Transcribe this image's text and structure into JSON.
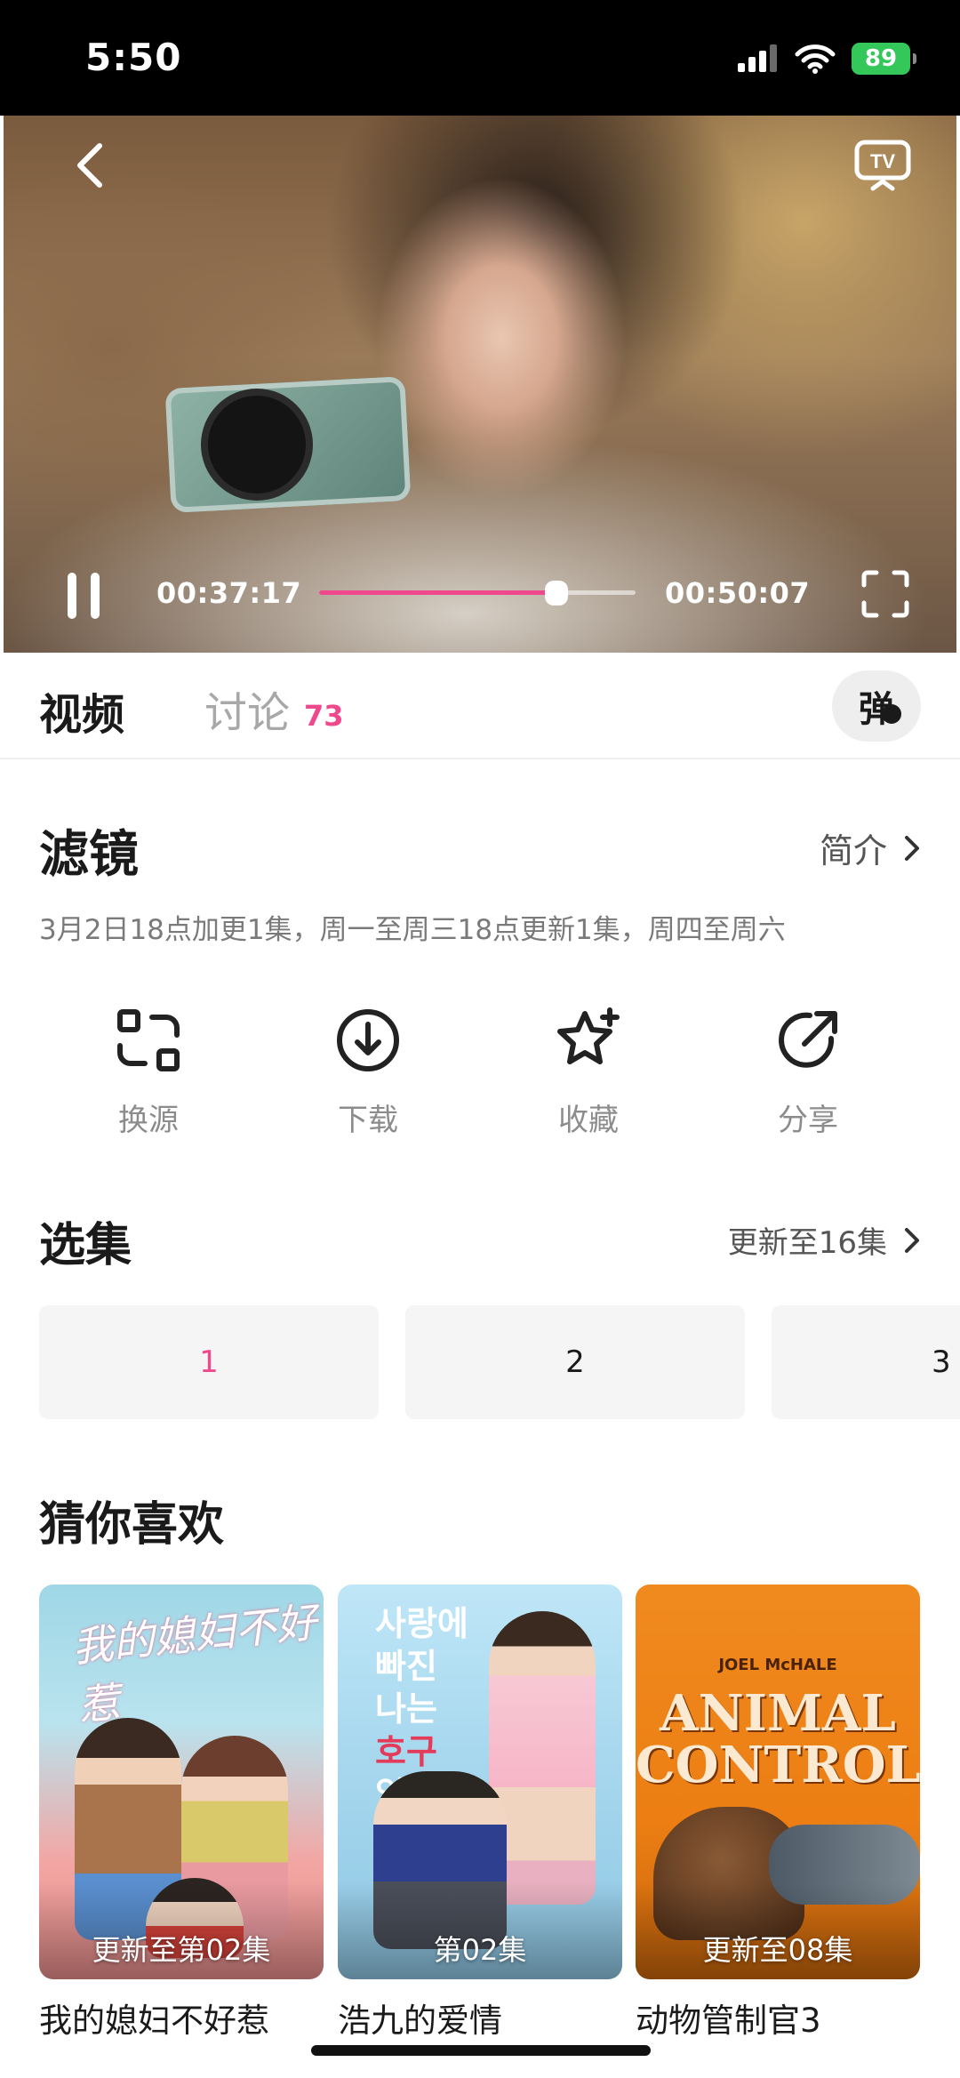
{
  "status_bar": {
    "time": "5:50",
    "battery": "89"
  },
  "player": {
    "current_time": "00:37:17",
    "total_time": "00:50:07",
    "progress": 0.75
  },
  "tabs": {
    "video": "视频",
    "discuss": "讨论",
    "discuss_count": "73",
    "danmu": "弹"
  },
  "show": {
    "title": "滤镜",
    "intro": "简介",
    "schedule": "3月2日18点加更1集，周一至周三18点更新1集，周四至周六"
  },
  "actions": [
    {
      "label": "换源",
      "icon": "switch-source-icon"
    },
    {
      "label": "下载",
      "icon": "download-icon"
    },
    {
      "label": "收藏",
      "icon": "favorite-star-icon"
    },
    {
      "label": "分享",
      "icon": "share-icon"
    }
  ],
  "episodes": {
    "title": "选集",
    "more": "更新至16集",
    "items": [
      "1",
      "2",
      "3"
    ],
    "active": "1"
  },
  "recommend": {
    "title": "猜你喜欢",
    "items": [
      {
        "name": "我的媳妇不好惹",
        "badge": "更新至第02集",
        "poster_text": "我的媳妇不好惹"
      },
      {
        "name": "浩九的爱情",
        "badge": "第02集",
        "poster_lines": [
          "사랑에",
          "빠진",
          "나는",
          "호구",
          "입니다"
        ]
      },
      {
        "name": "动物管制官3",
        "badge": "更新至08集",
        "poster_small": "JOEL McHALE",
        "poster_big": "ANIMAL CONTROL"
      }
    ]
  },
  "colors": {
    "accent": "#f0488d",
    "battery": "#34c759"
  }
}
